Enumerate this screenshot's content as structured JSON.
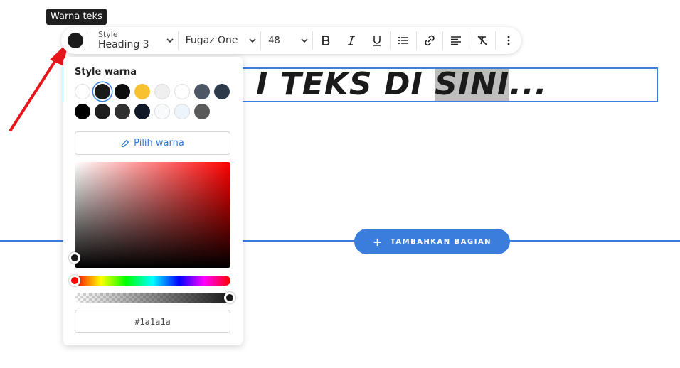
{
  "tooltip": {
    "text": "Warna teks"
  },
  "toolbar": {
    "text_color": "#1a1a1a",
    "style_label": "Style:",
    "style_value": "Heading 3",
    "font_value": "Fugaz One",
    "size_value": "48",
    "icons": [
      "bold-icon",
      "italic-icon",
      "underline-icon",
      "list-icon",
      "link-icon",
      "align-left-icon",
      "clear-format-icon",
      "more-vertical-icon"
    ]
  },
  "heading": {
    "text_before": "I TEKS DI ",
    "text_selected": "SINI",
    "text_after": "..."
  },
  "add_section": {
    "label": "TAMBAHKAN BAGIAN"
  },
  "color_picker": {
    "title": "Style warna",
    "swatches": [
      "#ffffff",
      "#1a1a1a",
      "#0d0d0d",
      "#f7c12f",
      "#efefef",
      "#ffffff",
      "#4b5563",
      "#2c3a4a",
      "#000000",
      "#1e1e1e",
      "#303030",
      "#111827",
      "#f9fafb",
      "#eef4fb",
      "#5a5a5a"
    ],
    "selected_swatch_index": 1,
    "pick_color_label": "Pilih warna",
    "hex_value": "#1a1a1a",
    "hue": 0,
    "saturation": 0,
    "brightness": 0.1,
    "alpha": 1
  }
}
